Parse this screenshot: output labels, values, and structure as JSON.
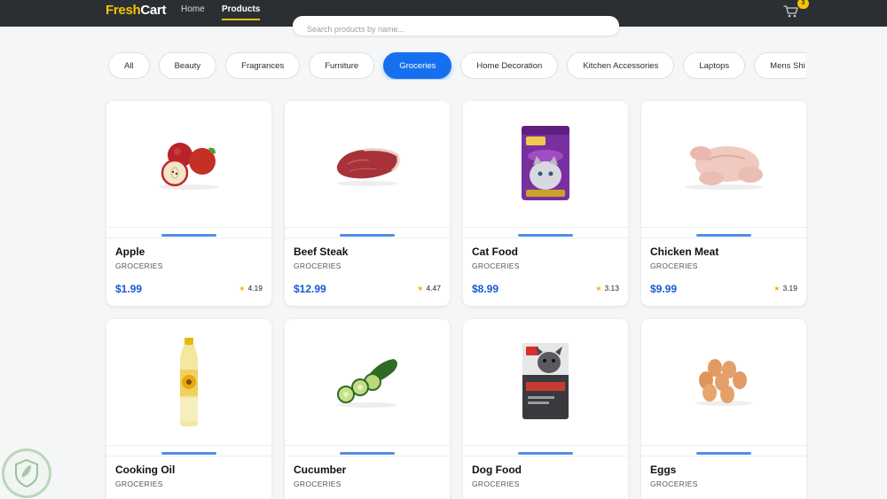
{
  "navbar": {
    "brand_part1": "Fresh",
    "brand_part2": "Cart",
    "links": [
      {
        "label": "Home",
        "active": false
      },
      {
        "label": "Products",
        "active": true
      }
    ],
    "cart_count": "3",
    "cart_icon": "cart-icon"
  },
  "search": {
    "placeholder": "Search products by name..."
  },
  "categories": [
    {
      "label": "All",
      "active": false
    },
    {
      "label": "Beauty",
      "active": false
    },
    {
      "label": "Fragrances",
      "active": false
    },
    {
      "label": "Furniture",
      "active": false
    },
    {
      "label": "Groceries",
      "active": true
    },
    {
      "label": "Home Decoration",
      "active": false
    },
    {
      "label": "Kitchen Accessories",
      "active": false
    },
    {
      "label": "Laptops",
      "active": false
    },
    {
      "label": "Mens Shirts",
      "active": false
    }
  ],
  "products": [
    {
      "title": "Apple",
      "category": "GROCERIES",
      "price": "$1.99",
      "rating": "4.19",
      "image": "apple-image"
    },
    {
      "title": "Beef Steak",
      "category": "GROCERIES",
      "price": "$12.99",
      "rating": "4.47",
      "image": "beef-steak-image"
    },
    {
      "title": "Cat Food",
      "category": "GROCERIES",
      "price": "$8.99",
      "rating": "3.13",
      "image": "cat-food-image"
    },
    {
      "title": "Chicken Meat",
      "category": "GROCERIES",
      "price": "$9.99",
      "rating": "3.19",
      "image": "chicken-meat-image"
    },
    {
      "title": "Cooking Oil",
      "category": "GROCERIES",
      "price": "",
      "rating": "",
      "image": "cooking-oil-image"
    },
    {
      "title": "Cucumber",
      "category": "GROCERIES",
      "price": "",
      "rating": "",
      "image": "cucumber-image"
    },
    {
      "title": "Dog Food",
      "category": "GROCERIES",
      "price": "",
      "rating": "",
      "image": "dog-food-image"
    },
    {
      "title": "Eggs",
      "category": "GROCERIES",
      "price": "",
      "rating": "",
      "image": "eggs-image"
    }
  ],
  "colors": {
    "navbar_bg": "#2b2f33",
    "brand_accent": "#f6c200",
    "active_category": "#1570ef",
    "price": "#1459d6",
    "star": "#f4b400"
  }
}
